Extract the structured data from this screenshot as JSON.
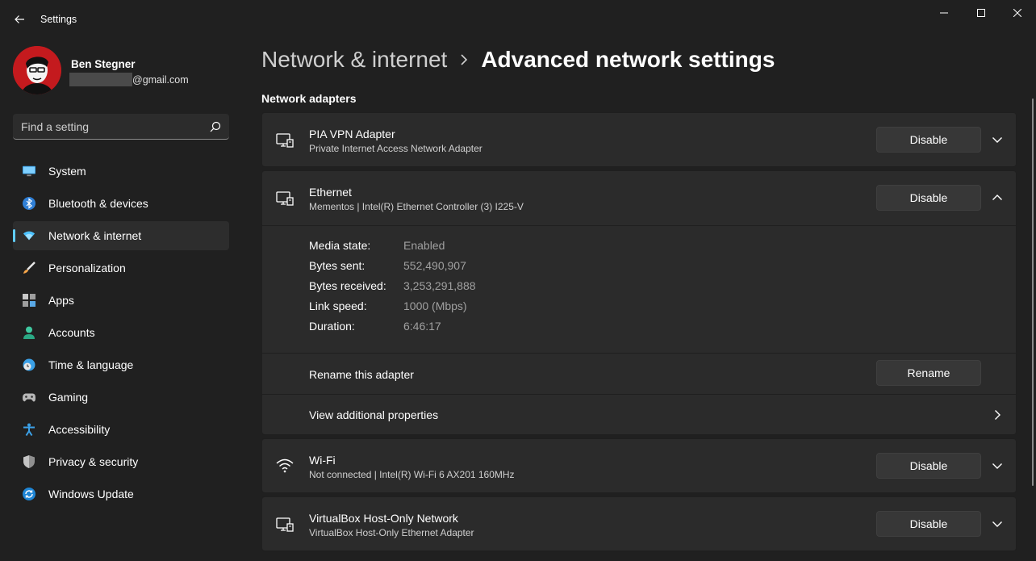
{
  "window": {
    "title": "Settings",
    "controls": [
      "minimize-icon",
      "maximize-icon",
      "close-icon"
    ]
  },
  "user": {
    "name": "Ben Stegner",
    "email_visible": "@gmail.com"
  },
  "search": {
    "placeholder": "Find a setting"
  },
  "sidebar": {
    "items": [
      {
        "label": "System",
        "icon": "monitor-icon",
        "active": false
      },
      {
        "label": "Bluetooth & devices",
        "icon": "bluetooth-icon",
        "active": false
      },
      {
        "label": "Network & internet",
        "icon": "wifi-icon",
        "active": true
      },
      {
        "label": "Personalization",
        "icon": "brush-icon",
        "active": false
      },
      {
        "label": "Apps",
        "icon": "apps-icon",
        "active": false
      },
      {
        "label": "Accounts",
        "icon": "person-icon",
        "active": false
      },
      {
        "label": "Time & language",
        "icon": "clock-globe-icon",
        "active": false
      },
      {
        "label": "Gaming",
        "icon": "gamepad-icon",
        "active": false
      },
      {
        "label": "Accessibility",
        "icon": "accessibility-icon",
        "active": false
      },
      {
        "label": "Privacy & security",
        "icon": "shield-icon",
        "active": false
      },
      {
        "label": "Windows Update",
        "icon": "update-icon",
        "active": false
      }
    ]
  },
  "breadcrumb": {
    "parent": "Network & internet",
    "current": "Advanced network settings"
  },
  "section": {
    "title": "Network adapters"
  },
  "adapters": {
    "pia": {
      "name": "PIA VPN Adapter",
      "desc": "Private Internet Access Network Adapter",
      "button": "Disable",
      "expanded": false
    },
    "ethernet": {
      "name": "Ethernet",
      "desc": "Mementos | Intel(R) Ethernet Controller (3) I225-V",
      "button": "Disable",
      "expanded": true,
      "properties": [
        {
          "label": "Media state:",
          "value": "Enabled"
        },
        {
          "label": "Bytes sent:",
          "value": "552,490,907"
        },
        {
          "label": "Bytes received:",
          "value": "3,253,291,888"
        },
        {
          "label": "Link speed:",
          "value": "1000 (Mbps)"
        },
        {
          "label": "Duration:",
          "value": "6:46:17"
        }
      ],
      "rename_label": "Rename this adapter",
      "rename_button": "Rename",
      "view_props_label": "View additional properties"
    },
    "wifi": {
      "name": "Wi-Fi",
      "desc": "Not connected | Intel(R) Wi-Fi 6 AX201 160MHz",
      "button": "Disable",
      "expanded": false
    },
    "vbox": {
      "name": "VirtualBox Host-Only Network",
      "desc": "VirtualBox Host-Only Ethernet Adapter",
      "button": "Disable",
      "expanded": false
    }
  },
  "colors": {
    "background": "#202020",
    "card": "#2b2b2b",
    "accent": "#60cdff",
    "button": "#373737"
  }
}
